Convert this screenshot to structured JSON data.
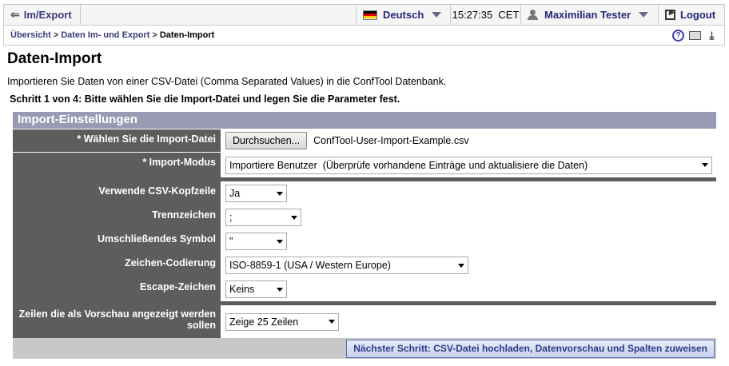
{
  "topbar": {
    "back_label": "Im/Export",
    "language": "Deutsch",
    "time": "15:27:35  CET",
    "user": "Maximilian Tester",
    "logout": "Logout"
  },
  "breadcrumb": {
    "items": [
      "Übersicht",
      "Daten Im- und Export",
      "Daten-Import"
    ],
    "separator": ">"
  },
  "page": {
    "title": "Daten-Import",
    "intro": "Importieren Sie Daten von einer CSV-Datei (Comma Separated Values) in die ConfTool Datenbank.",
    "step": "Schritt 1 von 4: Bitte wählen Sie die Import-Datei und legen Sie die Parameter fest."
  },
  "form": {
    "header": "Import-Einstellungen",
    "file_label": "* Wählen Sie die Import-Datei",
    "browse_button": "Durchsuchen...",
    "file_name": "ConfTool-User-Import-Example.csv",
    "mode_label": "* Import-Modus",
    "mode_value": "Importiere Benutzer  (Überprüfe vorhandene Einträge und aktualisiere die Daten)",
    "header_row_label": "Verwende CSV-Kopfzeile",
    "header_row_value": "Ja",
    "separator_label": "Trennzeichen",
    "separator_value": ";",
    "enclosure_label": "Umschließendes Symbol",
    "enclosure_value": "\"",
    "encoding_label": "Zeichen-Codierung",
    "encoding_value": "ISO-8859-1 (USA / Western Europe)",
    "escape_label": "Escape-Zeichen",
    "escape_value": "Keins",
    "preview_label": "Zeilen die als Vorschau angezeigt werden sollen",
    "preview_value": "Zeige 25 Zeilen",
    "next_button": "Nächster Schritt: CSV-Datei hochladen, Datenvorschau und Spalten zuweisen"
  },
  "colors": {
    "panel_header": "#9a9ab4",
    "label_bg": "#5d5d5d",
    "link": "#3a3a7a"
  }
}
